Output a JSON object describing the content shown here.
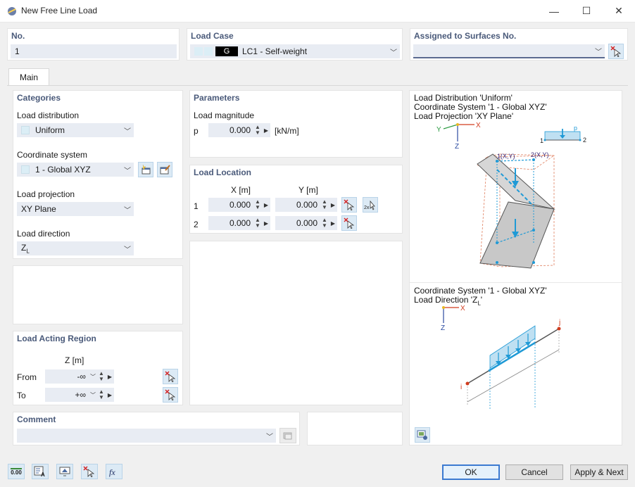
{
  "window": {
    "title": "New Free Line Load",
    "minimize": "—",
    "maximize": "☐",
    "close": "✕"
  },
  "header": {
    "no_label": "No.",
    "no_value": "1",
    "load_case_label": "Load Case",
    "load_case_tag": "G",
    "load_case_value": "LC1 - Self-weight",
    "assigned_label": "Assigned to Surfaces No.",
    "assigned_value": ""
  },
  "tabs": [
    {
      "label": "Main"
    }
  ],
  "categories": {
    "title": "Categories",
    "load_distribution_label": "Load distribution",
    "load_distribution_value": "Uniform",
    "coordinate_system_label": "Coordinate system",
    "coordinate_system_value": "1 - Global XYZ",
    "load_projection_label": "Load projection",
    "load_projection_value": "XY Plane",
    "load_direction_label": "Load direction",
    "load_direction_value": "Z",
    "load_direction_sub": "L"
  },
  "parameters": {
    "title": "Parameters",
    "magnitude_label": "Load magnitude",
    "p_label": "p",
    "p_value": "0.000",
    "p_unit": "[kN/m]"
  },
  "load_location": {
    "title": "Load Location",
    "col_x": "X [m]",
    "col_y": "Y [m]",
    "rows": [
      {
        "index": "1",
        "x": "0.000",
        "y": "0.000"
      },
      {
        "index": "2",
        "x": "0.000",
        "y": "0.000"
      }
    ]
  },
  "load_acting_region": {
    "title": "Load Acting Region",
    "col_z": "Z [m]",
    "from_label": "From",
    "from_value": "-∞",
    "to_label": "To",
    "to_value": "+∞"
  },
  "comment": {
    "title": "Comment",
    "value": ""
  },
  "preview": {
    "info1_line1": "Load Distribution 'Uniform'",
    "info1_line2": "Coordinate System '1 - Global XYZ'",
    "info1_line3": "Load Projection 'XY Plane'",
    "info2_line1": "Coordinate System '1 - Global XYZ'",
    "info2_line2": "Load Direction 'Z",
    "info2_line2_sub": "L",
    "info2_line2_end": "'",
    "axis_x": "X",
    "axis_y": "Y",
    "axis_z": "Z",
    "mini_p": "p",
    "mini_1": "1",
    "mini_2": "2",
    "pt1": "1(X,Y)",
    "pt2": "2(X,Y)",
    "node_i": "i",
    "node_j": "j"
  },
  "footer": {
    "ok": "OK",
    "cancel": "Cancel",
    "apply_next": "Apply & Next",
    "units_icon_text": "0.00"
  },
  "colors": {
    "accent": "#4a5a7a",
    "field_bg": "#e8ecf3",
    "load_blue": "#1f9ad6",
    "node_red": "#d23c1e"
  }
}
